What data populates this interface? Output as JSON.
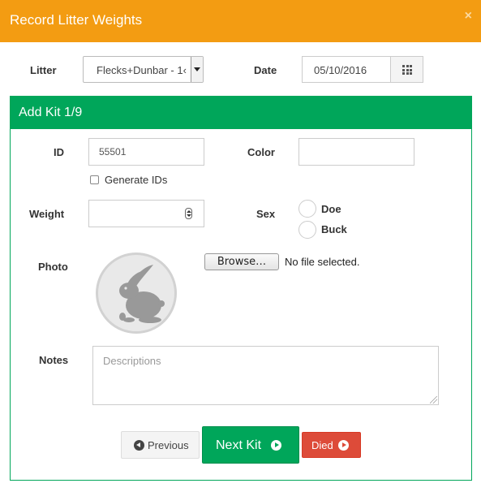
{
  "modal": {
    "title": "Record Litter Weights",
    "close_symbol": "×"
  },
  "form": {
    "litter_label": "Litter",
    "litter_value": "Flecks+Dunbar - 1‹",
    "date_label": "Date",
    "date_value": "05/10/2016",
    "date_icon": "calendar-grid-icon"
  },
  "panel": {
    "title": "Add Kit 1/9",
    "id_label": "ID",
    "id_value": "55501",
    "color_label": "Color",
    "color_value": "",
    "generate_ids_label": "Generate IDs",
    "weight_label": "Weight",
    "weight_value": "",
    "sex_label": "Sex",
    "sex_options": [
      "Doe",
      "Buck"
    ],
    "photo_label": "Photo",
    "browse_label": "Browse…",
    "file_status": "No file selected.",
    "notes_label": "Notes",
    "notes_placeholder": "Descriptions"
  },
  "buttons": {
    "previous": "Previous",
    "next": "Next Kit",
    "died": "Died"
  },
  "colors": {
    "header": "#f39c12",
    "success": "#00a65a",
    "danger": "#dd4b39"
  }
}
